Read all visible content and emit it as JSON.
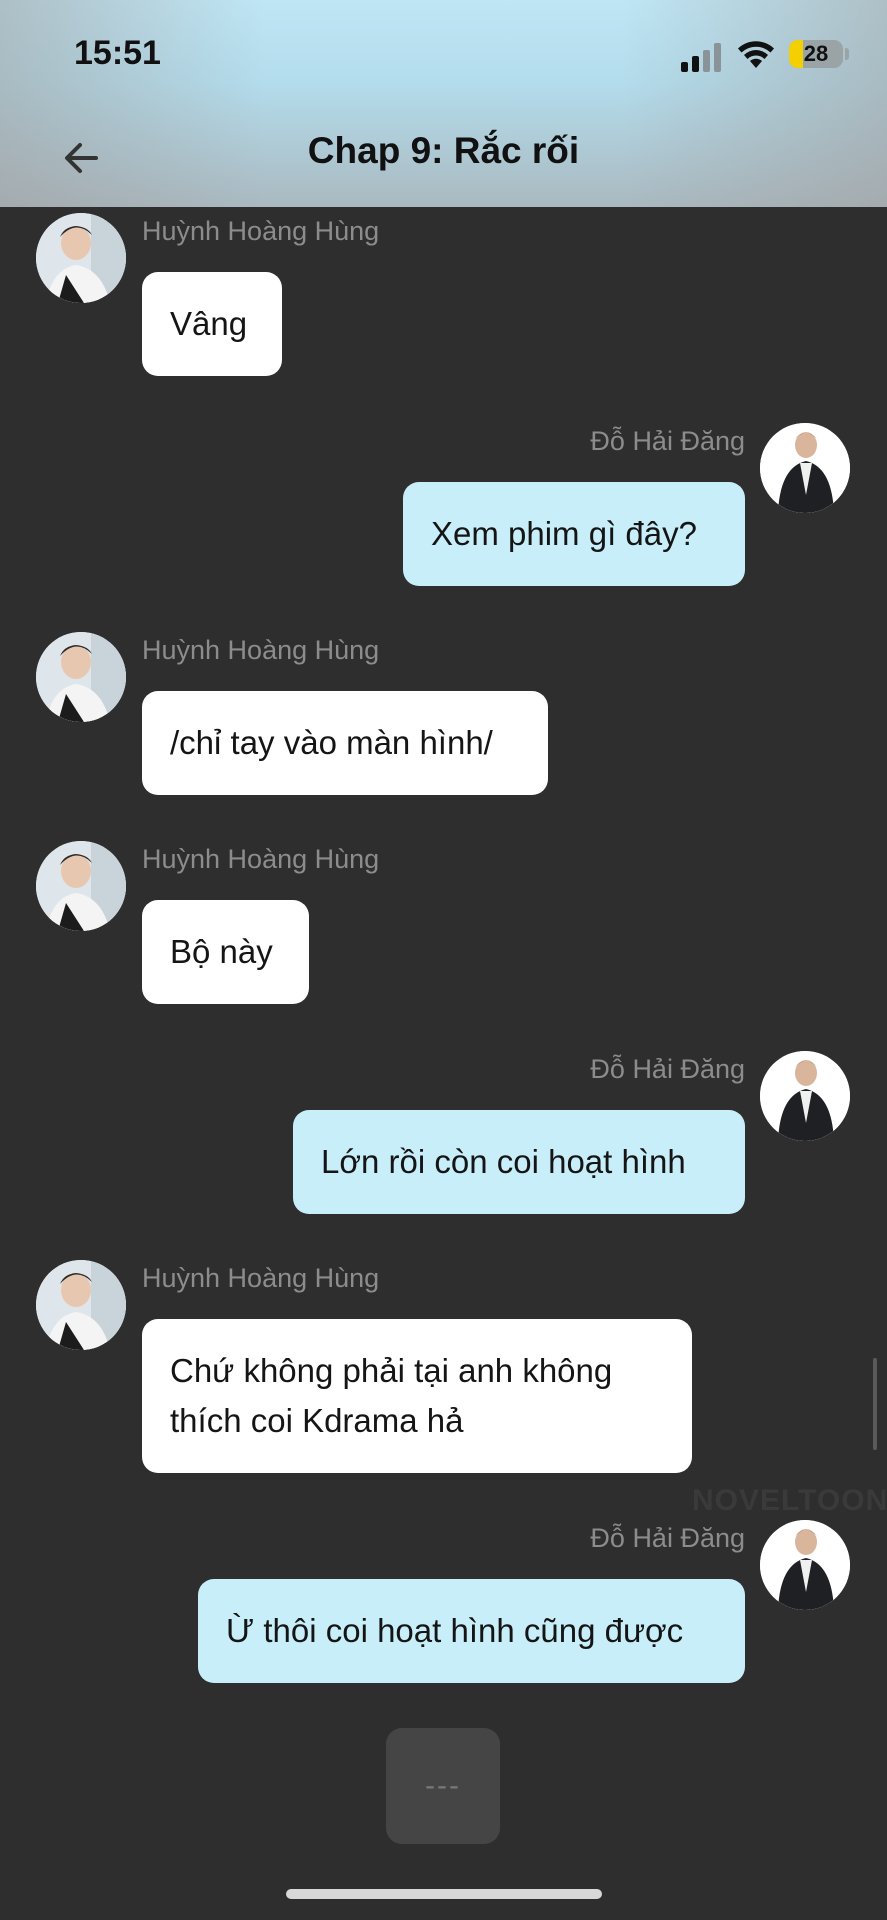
{
  "status_bar": {
    "time": "15:51",
    "battery": "28"
  },
  "header": {
    "title": "Chap 9: Rắc rối"
  },
  "watermark": "NOVELTOON",
  "more_button": "---",
  "messages": [
    {
      "sender": "Huỳnh Hoàng Hùng",
      "side": "left",
      "text": "Vâng"
    },
    {
      "sender": "Đỗ Hải Đăng",
      "side": "right",
      "text": "Xem phim gì đây?"
    },
    {
      "sender": "Huỳnh Hoàng Hùng",
      "side": "left",
      "text": "/chỉ tay vào màn hình/"
    },
    {
      "sender": "Huỳnh Hoàng Hùng",
      "side": "left",
      "text": "Bộ này"
    },
    {
      "sender": "Đỗ Hải Đăng",
      "side": "right",
      "text": "Lớn rồi còn coi hoạt hình"
    },
    {
      "sender": "Huỳnh Hoàng Hùng",
      "side": "left",
      "text_lines": [
        "Chứ không phải tại anh không",
        "thích coi Kdrama hả"
      ]
    },
    {
      "sender": "Đỗ Hải Đăng",
      "side": "right",
      "text": "Ừ thôi coi hoạt hình cũng được"
    }
  ]
}
